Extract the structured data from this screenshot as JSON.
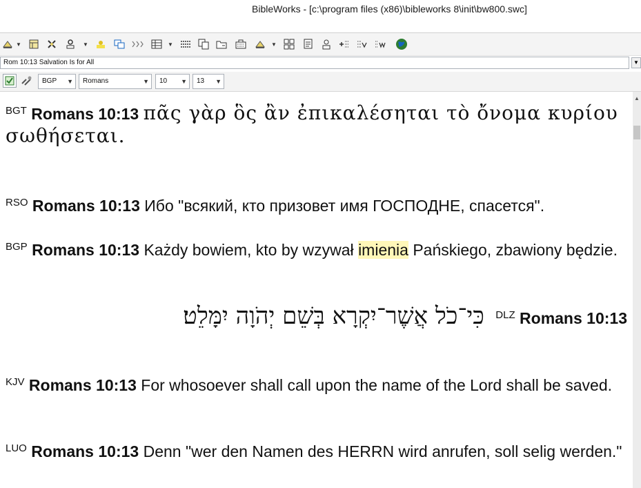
{
  "window": {
    "title": "BibleWorks - [c:\\program files (x86)\\bibleworks 8\\init\\bw800.swc]"
  },
  "toolbar": {
    "items": [
      {
        "name": "search-tool-icon"
      },
      {
        "name": "open-book-icon"
      },
      {
        "name": "tools-icon"
      },
      {
        "name": "stamp-icon"
      },
      {
        "name": "highlight-icon"
      },
      {
        "name": "windows-icon"
      },
      {
        "name": "arrows-icon"
      },
      {
        "name": "grid-icon"
      },
      {
        "name": "list-icon"
      },
      {
        "name": "copy-icon"
      },
      {
        "name": "folder-icon"
      },
      {
        "name": "keyboard-icon"
      },
      {
        "name": "person-icon"
      },
      {
        "name": "layout-icon"
      },
      {
        "name": "notes-icon"
      },
      {
        "name": "user-icon"
      },
      {
        "name": "add-list-icon"
      },
      {
        "name": "ev-icon"
      },
      {
        "name": "ew-icon"
      },
      {
        "name": "globe-icon"
      }
    ]
  },
  "verse_bar": {
    "value": "Rom 10:13 Salvation Is for All"
  },
  "nav": {
    "version": "BGP",
    "book": "Romans",
    "chapter": "10",
    "verse": "13"
  },
  "verses": [
    {
      "version": "BGT",
      "reference": "Romans 10:13",
      "text": "πᾶς γὰρ ὃς ἂν ἐπικαλέσηται τὸ ὄνομα κυρίου σωθήσεται."
    },
    {
      "version": "RSO",
      "reference": "Romans 10:13",
      "text": "Ибо \"всякий, кто призовет имя ГОСПОДНЕ, спасется\"."
    },
    {
      "version": "BGP",
      "reference": "Romans 10:13",
      "text_before": "Każdy bowiem, kto by wzywał",
      "highlight": "imienia",
      "text_after": "Pańskiego, zbawiony będzie."
    },
    {
      "version": "DLZ",
      "reference": "Romans 10:13",
      "text": "כִּי־כֹל אֲשֶׁר־יִקְרָא בְּשֵׁם יְהֹוָה יִמָּלֵט׃"
    },
    {
      "version": "KJV",
      "reference": "Romans 10:13",
      "text": "For whosoever shall call upon the name of the Lord shall be saved."
    },
    {
      "version": "LUO",
      "reference": "Romans 10:13",
      "text": "Denn \"wer den Namen des HERRN wird anrufen, soll selig werden.\""
    }
  ],
  "colors": {
    "highlight": "#fff7b8",
    "toolbar_bg": "#f4f4f4"
  }
}
